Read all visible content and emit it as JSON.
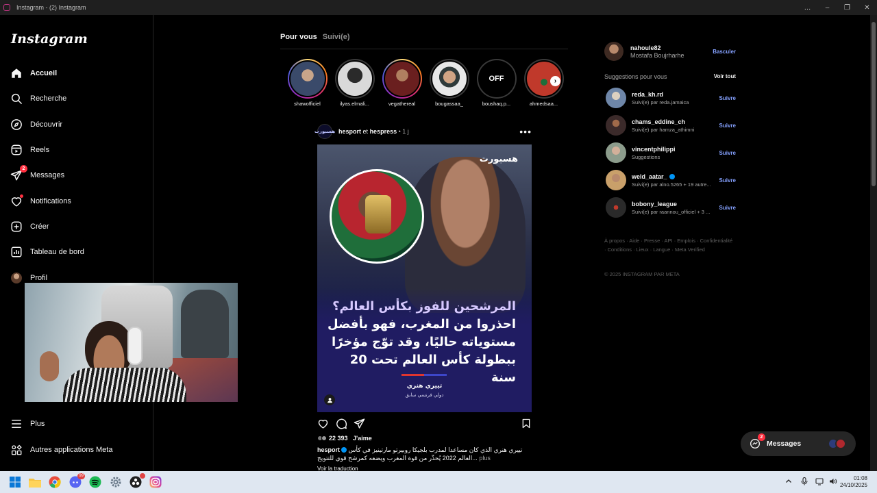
{
  "window": {
    "title": "Instagram - (2) Instagram",
    "controls": [
      "…",
      "–",
      "❐",
      "✕"
    ]
  },
  "brand": {
    "logo": "Instagram"
  },
  "nav": {
    "home": "Accueil",
    "search": "Recherche",
    "explore": "Découvrir",
    "reels": "Reels",
    "messages": "Messages",
    "messages_badge": "2",
    "notifications": "Notifications",
    "create": "Créer",
    "dashboard": "Tableau de bord",
    "profile": "Profil",
    "more": "Plus",
    "meta_apps": "Autres applications Meta"
  },
  "feed_tabs": {
    "for_you": "Pour vous",
    "following": "Suivi(e)"
  },
  "stories": [
    {
      "name": "shawofficiel",
      "seen": false,
      "color": "#3a4a6a"
    },
    {
      "name": "ilyas.elmali...",
      "seen": true,
      "color": "#d9d9d9"
    },
    {
      "name": "vegathereal",
      "seen": false,
      "color": "#6a1f1f"
    },
    {
      "name": "bougassaa_",
      "seen": true,
      "color": "#e8e8e8"
    },
    {
      "name": "boushaq.p...",
      "seen": true,
      "color": "#000000",
      "label": "OFF"
    },
    {
      "name": "ahmedsaa...",
      "seen": true,
      "color": "#b23a3a"
    }
  ],
  "post": {
    "author": "hesport",
    "connector": "et",
    "coauthor": "hespress",
    "time": "• 1 j",
    "avatar_text": "هسبورت",
    "image": {
      "brand": "هسبورت",
      "headline_highlight": "المرشحين للفوز بكأس العالم؟",
      "headline": "احذروا من المغرب، فهو بأفضل مستوياته حاليًا، وقد توّج مؤخرًا ببطولة كأس العالم تحت 20 سنة",
      "signer": "تييري هنري",
      "signer_sub": "دولي فرنسي سابق"
    },
    "likes_count": "22 393",
    "likes_label": "J'aime",
    "caption_user": "hesport",
    "caption_text": "تييري هنري الذي كان مساعدا لمدرب بلجيكا روبيرتو مارتينيز في كأس العالم 2022 يُحذّر من قوة المغرب ويضعه كمرشح قوي للتتويج...",
    "caption_more": "plus",
    "translate": "Voir la traduction"
  },
  "account": {
    "username": "nahoule82",
    "fullname": "Mostafa Boujrharhe",
    "switch": "Basculer"
  },
  "suggestions": {
    "title": "Suggestions pour vous",
    "see_all": "Voir tout",
    "follow_label": "Suivre",
    "items": [
      {
        "username": "reda_kh.rd",
        "sub": "Suivi(e) par reda.jamaica",
        "verified": false,
        "color": "#6e86a8"
      },
      {
        "username": "chams_eddine_ch",
        "sub": "Suivi(e) par hamza_athimni",
        "verified": false,
        "color": "#3b2a2a"
      },
      {
        "username": "vincentphilippi",
        "sub": "Suggestions",
        "verified": false,
        "color": "#8c9c8c"
      },
      {
        "username": "weld_aatar_",
        "sub": "Suivi(e) par alno.5265 + 19 autre...",
        "verified": true,
        "color": "#c9a06a"
      },
      {
        "username": "bobony_league",
        "sub": "Suivi(e) par raannou_officiel + 3 ...",
        "verified": false,
        "color": "#2a2a2a"
      }
    ]
  },
  "footer": {
    "links": "À propos · Aide · Presse · API · Emplois · Confidentialité · Conditions · Lieux · Langue · Meta Verified",
    "copyright": "© 2025 INSTAGRAM PAR META"
  },
  "messages_pill": {
    "label": "Messages",
    "badge": "2"
  },
  "taskbar": {
    "discord_badge": "99",
    "time": "01:08",
    "date": "24/10/2025"
  },
  "colors": {
    "accent": "#85a1ff",
    "badge": "#ff3040",
    "verified": "#0095f6"
  }
}
